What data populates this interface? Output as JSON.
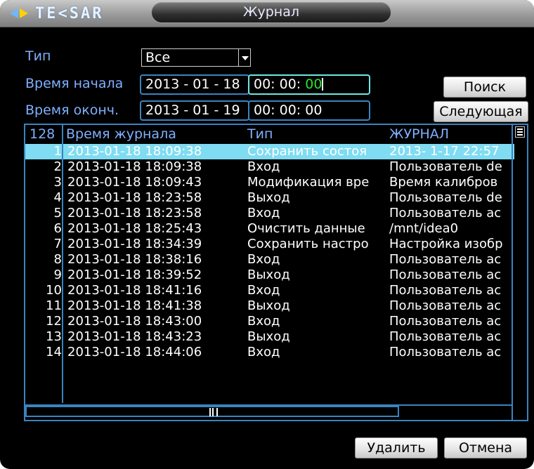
{
  "title": {
    "logo": "TE<SAR",
    "window_title": "Журнал"
  },
  "form": {
    "type_label": "Тип",
    "type_value": "Все",
    "start_label": "Время начала",
    "start_date": "2013 - 01 - 18",
    "start_time_hm": "00: 00:",
    "start_time_s": "00",
    "end_label": "Время оконч.",
    "end_date": "2013 - 01 - 19",
    "end_time": "00: 00: 00"
  },
  "buttons": {
    "search": "Поиск",
    "next": "Следующая",
    "delete": "Удалить",
    "cancel": "Отмена"
  },
  "table": {
    "count": "128",
    "columns": [
      "Время журнала",
      "Тип",
      "ЖУРНАЛ"
    ],
    "rows": [
      {
        "num": "1",
        "time": "2013-01-18 18:09:38",
        "type": "Сохранить состоя",
        "log": "2013- 1-17 22:57"
      },
      {
        "num": "2",
        "time": "2013-01-18 18:09:38",
        "type": "Вход",
        "log": "Пользователь de"
      },
      {
        "num": "3",
        "time": "2013-01-18 18:09:43",
        "type": "Модификация вре",
        "log": "Время калибров"
      },
      {
        "num": "4",
        "time": "2013-01-18 18:23:58",
        "type": "Выход",
        "log": "Пользователь de"
      },
      {
        "num": "5",
        "time": "2013-01-18 18:23:58",
        "type": "Вход",
        "log": "Пользователь ac"
      },
      {
        "num": "6",
        "time": "2013-01-18 18:25:43",
        "type": "Очистить данные",
        "log": "/mnt/idea0"
      },
      {
        "num": "7",
        "time": "2013-01-18 18:34:39",
        "type": "Сохранить настро",
        "log": "Настройка изобр"
      },
      {
        "num": "8",
        "time": "2013-01-18 18:38:16",
        "type": "Вход",
        "log": "Пользователь ac"
      },
      {
        "num": "9",
        "time": "2013-01-18 18:39:52",
        "type": "Выход",
        "log": "Пользователь ac"
      },
      {
        "num": "10",
        "time": "2013-01-18 18:41:16",
        "type": "Вход",
        "log": "Пользователь ac"
      },
      {
        "num": "11",
        "time": "2013-01-18 18:41:38",
        "type": "Выход",
        "log": "Пользователь ac"
      },
      {
        "num": "12",
        "time": "2013-01-18 18:43:00",
        "type": "Вход",
        "log": "Пользователь ac"
      },
      {
        "num": "13",
        "time": "2013-01-18 18:43:23",
        "type": "Выход",
        "log": "Пользователь ac"
      },
      {
        "num": "14",
        "time": "2013-01-18 18:44:06",
        "type": "Вход",
        "log": "Пользователь ac"
      }
    ],
    "selected_row": "1"
  },
  "colors": {
    "accent_blue": "#3a84c0",
    "label_blue": "#7fb0ff",
    "selected_row": "#7fdcf2",
    "active_digit": "#29e52a"
  },
  "icons": {
    "logo": "tesar-logo-icon",
    "dropdown": "chevron-down-icon",
    "scroll": "scroll-grip-icon"
  }
}
